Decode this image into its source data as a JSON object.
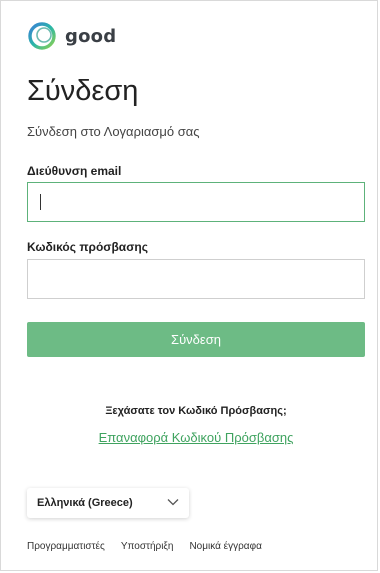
{
  "brand": {
    "name": "good",
    "accent": "#6dbb85",
    "link_color": "#3fa35f"
  },
  "login": {
    "title": "Σύνδεση",
    "subtitle": "Σύνδεση στο Λογαριασμό σας",
    "email_label": "Διεύθυνση email",
    "email_value": "",
    "password_label": "Κωδικός πρόσβασης",
    "password_value": "",
    "submit_label": "Σύνδεση",
    "forgot_text": "Ξεχάσατε τον Κωδικό Πρόσβασης;",
    "reset_link": "Επαναφορά Κωδικού Πρόσβασης"
  },
  "language": {
    "selected": "Ελληνικά (Greece)",
    "icon": "chevron-down-icon"
  },
  "footer": {
    "links": [
      "Προγραμματιστές",
      "Υποστήριξη",
      "Νομικά έγγραφα"
    ]
  }
}
